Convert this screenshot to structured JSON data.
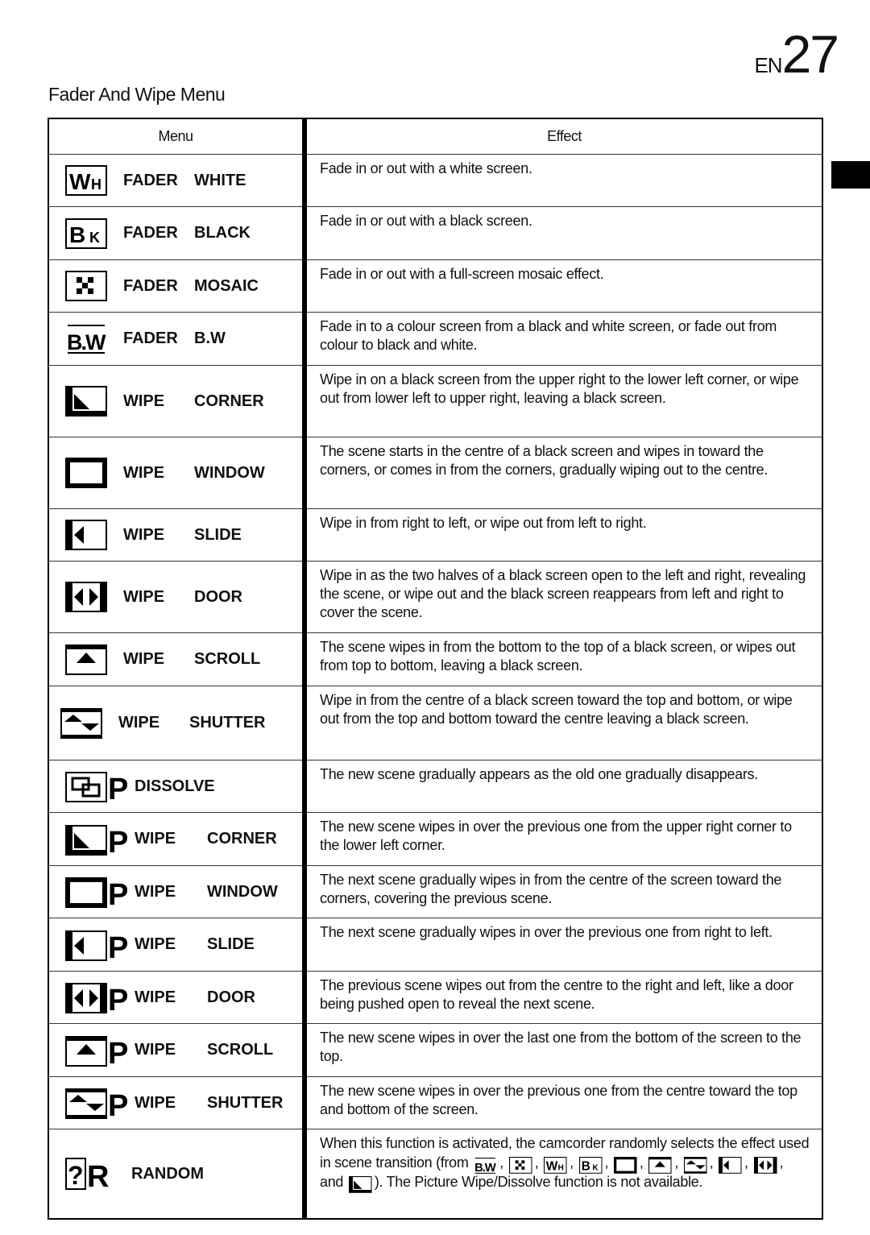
{
  "page": {
    "prefix": "EN",
    "number": "27"
  },
  "section_title": "Fader And Wipe Menu",
  "table": {
    "headers": {
      "menu": "Menu",
      "effect": "Effect"
    },
    "rows": [
      {
        "icon": "fader-white-icon",
        "kind": "FADER",
        "name": "WHITE",
        "effect": "Fade in or out with a white screen."
      },
      {
        "icon": "fader-black-icon",
        "kind": "FADER",
        "name": "BLACK",
        "effect": "Fade in or out with a black screen."
      },
      {
        "icon": "fader-mosaic-icon",
        "kind": "FADER",
        "name": "MOSAIC",
        "effect": "Fade in or out with a full-screen mosaic effect."
      },
      {
        "icon": "fader-bw-icon",
        "kind": "FADER",
        "name": "B.W",
        "effect": "Fade in to a colour screen from a black and white screen, or fade out from colour to black and white."
      },
      {
        "icon": "wipe-corner-icon",
        "kind": "WIPE",
        "name": "CORNER",
        "effect": "Wipe in on a black screen from the upper right to the lower left corner, or wipe out from lower left to upper right, leaving a black screen."
      },
      {
        "icon": "wipe-window-icon",
        "kind": "WIPE",
        "name": "WINDOW",
        "effect": "The scene starts in the centre of a black screen and wipes in toward the corners, or comes in from the corners, gradually wiping out to the centre."
      },
      {
        "icon": "wipe-slide-icon",
        "kind": "WIPE",
        "name": "SLIDE",
        "effect": "Wipe in from right to left, or wipe out from left to right."
      },
      {
        "icon": "wipe-door-icon",
        "kind": "WIPE",
        "name": "DOOR",
        "effect": "Wipe in as the two halves of a black screen open to the left and right, revealing the scene, or wipe out and the black screen reappears from left and right to cover the scene."
      },
      {
        "icon": "wipe-scroll-icon",
        "kind": "WIPE",
        "name": "SCROLL",
        "effect": "The scene wipes in from the bottom to the top of a black screen, or wipes out from top to bottom, leaving a black screen."
      },
      {
        "icon": "wipe-shutter-icon",
        "kind": "WIPE",
        "name": "SHUTTER",
        "effect": "Wipe in from the centre of a black screen toward the top and bottom, or wipe out from the top and bottom toward the centre leaving a black screen."
      },
      {
        "icon": "picture-dissolve-icon",
        "kind": "DISSOLVE",
        "name": "",
        "effect": "The new scene gradually appears as the old one gradually disappears."
      },
      {
        "icon": "picture-wipe-corner-icon",
        "kind": "WIPE",
        "name": "CORNER",
        "effect": "The new scene wipes in over the previous one from the upper right corner to the lower left corner."
      },
      {
        "icon": "picture-wipe-window-icon",
        "kind": "WIPE",
        "name": "WINDOW",
        "effect": "The next scene gradually wipes in from the centre of the screen toward the corners, covering the previous scene."
      },
      {
        "icon": "picture-wipe-slide-icon",
        "kind": "WIPE",
        "name": "SLIDE",
        "effect": "The next scene gradually wipes in over the previous one from right to left."
      },
      {
        "icon": "picture-wipe-door-icon",
        "kind": "WIPE",
        "name": "DOOR",
        "effect": "The previous scene wipes out from the centre to the right and left, like a door being pushed open to reveal the next scene."
      },
      {
        "icon": "picture-wipe-scroll-icon",
        "kind": "WIPE",
        "name": "SCROLL",
        "effect": "The new scene wipes in over the last one from the bottom of the screen to the top."
      },
      {
        "icon": "picture-wipe-shutter-icon",
        "kind": "WIPE",
        "name": "SHUTTER",
        "effect": "The new scene wipes in over the previous one from the centre toward the top and bottom of the screen."
      }
    ],
    "random": {
      "icon": "random-icon",
      "name": "RANDOM",
      "effect_before": "When this function is activated, the camcorder randomly selects the effect used in scene transition (from",
      "effect_and": ", and",
      "effect_after": "). The Picture Wipe/Dissolve function is not available."
    }
  }
}
